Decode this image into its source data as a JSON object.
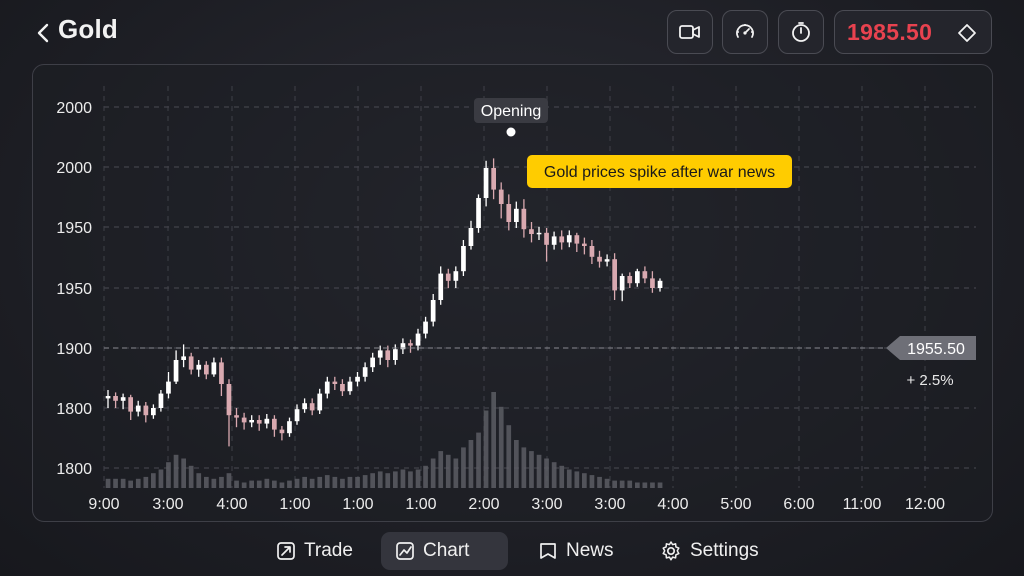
{
  "header": {
    "title": "Gold",
    "price": "1985.50",
    "price_color": "#e8424f",
    "buttons": [
      "video-icon",
      "speedometer-icon",
      "timer-icon"
    ]
  },
  "chart_data": {
    "type": "candlestick",
    "y_ticks": [
      "2000",
      "2000",
      "1950",
      "1950",
      "1900",
      "1800",
      "1800"
    ],
    "x_ticks": [
      "9:00",
      "3:00",
      "4:00",
      "1:00",
      "1:00",
      "1:00",
      "2:00",
      "3:00",
      "3:00",
      "4:00",
      "5:00",
      "6:00",
      "11:00",
      "12:00"
    ],
    "grid": true,
    "annotation_label": "Opening",
    "callout": "Gold prices spike after war news",
    "callout_color": "#ffcc00",
    "current_price_label": "1955.50",
    "change_label": "+ 2.5%",
    "up_color": "#ffffff",
    "down_color": "#d9a9b0",
    "candles": [
      [
        1808,
        1810,
        1800,
        1815
      ],
      [
        1810,
        1806,
        1800,
        1813
      ],
      [
        1806,
        1809,
        1799,
        1812
      ],
      [
        1809,
        1797,
        1790,
        1811
      ],
      [
        1797,
        1802,
        1793,
        1806
      ],
      [
        1802,
        1794,
        1788,
        1805
      ],
      [
        1794,
        1800,
        1791,
        1803
      ],
      [
        1800,
        1812,
        1797,
        1815
      ],
      [
        1812,
        1822,
        1808,
        1830
      ],
      [
        1822,
        1840,
        1820,
        1848
      ],
      [
        1840,
        1843,
        1834,
        1853
      ],
      [
        1843,
        1832,
        1828,
        1846
      ],
      [
        1832,
        1836,
        1826,
        1840
      ],
      [
        1836,
        1828,
        1824,
        1839
      ],
      [
        1828,
        1838,
        1826,
        1842
      ],
      [
        1838,
        1820,
        1810,
        1842
      ],
      [
        1820,
        1794,
        1768,
        1824
      ],
      [
        1794,
        1792,
        1784,
        1800
      ],
      [
        1792,
        1788,
        1782,
        1796
      ],
      [
        1788,
        1790,
        1784,
        1794
      ],
      [
        1790,
        1787,
        1781,
        1794
      ],
      [
        1787,
        1791,
        1783,
        1795
      ],
      [
        1791,
        1782,
        1776,
        1794
      ],
      [
        1782,
        1779,
        1773,
        1785
      ],
      [
        1779,
        1789,
        1776,
        1792
      ],
      [
        1789,
        1799,
        1786,
        1803
      ],
      [
        1799,
        1804,
        1796,
        1808
      ],
      [
        1804,
        1798,
        1794,
        1808
      ],
      [
        1798,
        1812,
        1795,
        1816
      ],
      [
        1812,
        1822,
        1808,
        1826
      ],
      [
        1822,
        1820,
        1815,
        1826
      ],
      [
        1820,
        1814,
        1810,
        1824
      ],
      [
        1814,
        1822,
        1811,
        1826
      ],
      [
        1822,
        1826,
        1818,
        1830
      ],
      [
        1826,
        1834,
        1822,
        1838
      ],
      [
        1834,
        1842,
        1830,
        1846
      ],
      [
        1842,
        1848,
        1836,
        1852
      ],
      [
        1848,
        1840,
        1834,
        1852
      ],
      [
        1840,
        1849,
        1836,
        1853
      ],
      [
        1849,
        1854,
        1845,
        1858
      ],
      [
        1854,
        1852,
        1846,
        1857
      ],
      [
        1852,
        1862,
        1848,
        1866
      ],
      [
        1862,
        1872,
        1858,
        1876
      ],
      [
        1872,
        1890,
        1868,
        1895
      ],
      [
        1890,
        1912,
        1886,
        1918
      ],
      [
        1912,
        1906,
        1900,
        1916
      ],
      [
        1906,
        1914,
        1900,
        1918
      ],
      [
        1914,
        1935,
        1910,
        1940
      ],
      [
        1935,
        1950,
        1932,
        1956
      ],
      [
        1950,
        1975,
        1946,
        1978
      ],
      [
        1975,
        2000,
        1968,
        2006
      ],
      [
        2000,
        1982,
        1974,
        2008
      ],
      [
        1982,
        1970,
        1958,
        1988
      ],
      [
        1970,
        1955,
        1948,
        1978
      ],
      [
        1955,
        1966,
        1950,
        1972
      ],
      [
        1966,
        1949,
        1942,
        1974
      ],
      [
        1949,
        1945,
        1938,
        1955
      ],
      [
        1945,
        1946,
        1940,
        1951
      ],
      [
        1946,
        1936,
        1922,
        1950
      ],
      [
        1936,
        1943,
        1932,
        1947
      ],
      [
        1943,
        1938,
        1932,
        1948
      ],
      [
        1938,
        1944,
        1934,
        1948
      ],
      [
        1944,
        1937,
        1930,
        1946
      ],
      [
        1937,
        1935,
        1928,
        1942
      ],
      [
        1935,
        1926,
        1920,
        1940
      ],
      [
        1926,
        1922,
        1917,
        1931
      ],
      [
        1922,
        1924,
        1918,
        1928
      ],
      [
        1924,
        1898,
        1890,
        1929
      ],
      [
        1898,
        1910,
        1889,
        1912
      ],
      [
        1910,
        1904,
        1900,
        1913
      ],
      [
        1904,
        1914,
        1901,
        1916
      ],
      [
        1914,
        1908,
        1904,
        1918
      ],
      [
        1908,
        1900,
        1896,
        1914
      ],
      [
        1900,
        1906,
        1897,
        1908
      ]
    ],
    "volume": [
      5,
      5,
      5,
      4,
      5,
      6,
      8,
      10,
      14,
      18,
      16,
      12,
      8,
      6,
      5,
      6,
      8,
      4,
      3,
      4,
      4,
      5,
      4,
      3,
      4,
      5,
      6,
      5,
      6,
      7,
      6,
      5,
      6,
      6,
      7,
      8,
      9,
      8,
      9,
      10,
      9,
      10,
      12,
      16,
      20,
      18,
      16,
      22,
      26,
      30,
      42,
      52,
      44,
      34,
      26,
      22,
      20,
      18,
      16,
      14,
      12,
      10,
      9,
      8,
      7,
      6,
      5,
      4,
      4,
      4,
      3,
      3,
      3,
      3
    ]
  },
  "nav": {
    "items": [
      {
        "label": "Trade",
        "icon": "trade-icon"
      },
      {
        "label": "Chart",
        "icon": "chart-icon"
      },
      {
        "label": "News",
        "icon": "news-icon"
      },
      {
        "label": "Settings",
        "icon": "settings-icon"
      }
    ],
    "active": "Chart"
  }
}
